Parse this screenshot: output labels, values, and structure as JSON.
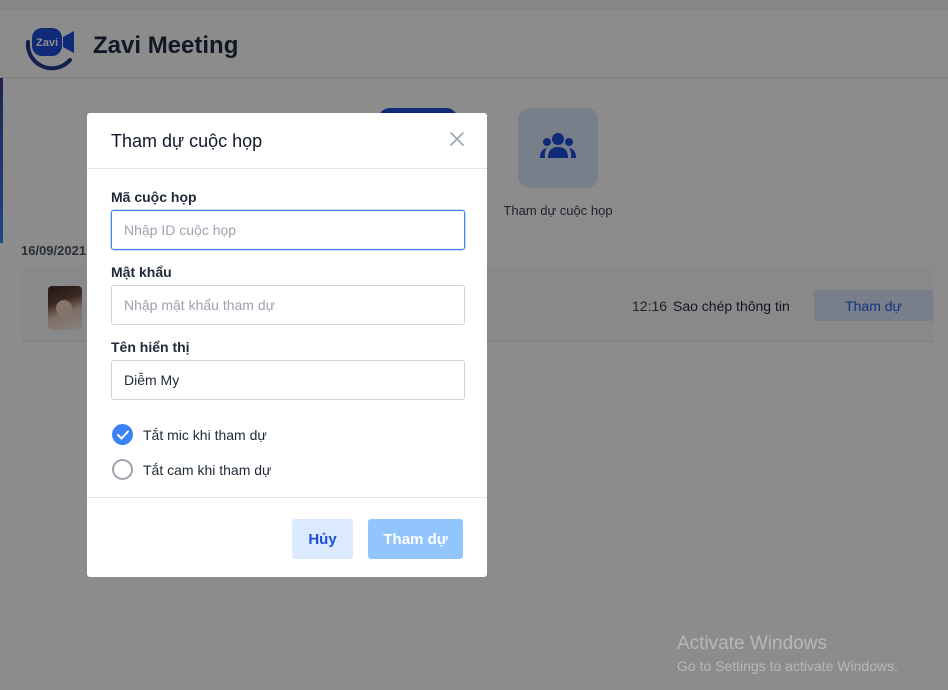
{
  "app": {
    "title": "Zavi Meeting",
    "logo_text": "Zavi"
  },
  "actions": {
    "join_label": "Tham dự cuộc họp"
  },
  "history": {
    "date": "16/09/2021",
    "row": {
      "time": "12:16",
      "copy_label": "Sao chép thông tin",
      "join_label": "Tham dự"
    }
  },
  "modal": {
    "title": "Tham dự cuộc họp",
    "meeting_id": {
      "label": "Mã cuộc họp",
      "placeholder": "Nhập ID cuộc họp",
      "value": ""
    },
    "password": {
      "label": "Mật khẩu",
      "placeholder": "Nhập mật khẩu tham dự",
      "value": ""
    },
    "display_name": {
      "label": "Tên hiển thị",
      "placeholder": "",
      "value": "Diễm My"
    },
    "options": [
      {
        "label": "Tắt mic khi tham dự",
        "checked": true
      },
      {
        "label": "Tắt cam khi tham dự",
        "checked": false
      }
    ],
    "cancel_label": "Hủy",
    "join_label": "Tham dự"
  },
  "watermark": {
    "title": "Activate Windows",
    "subtitle": "Go to Settings to activate Windows."
  },
  "colors": {
    "accent": "#3b82f6",
    "brand": "#1d4ed8",
    "join_disabled": "#93c5fd",
    "overlay": "rgba(0,0,0,0.45)"
  }
}
